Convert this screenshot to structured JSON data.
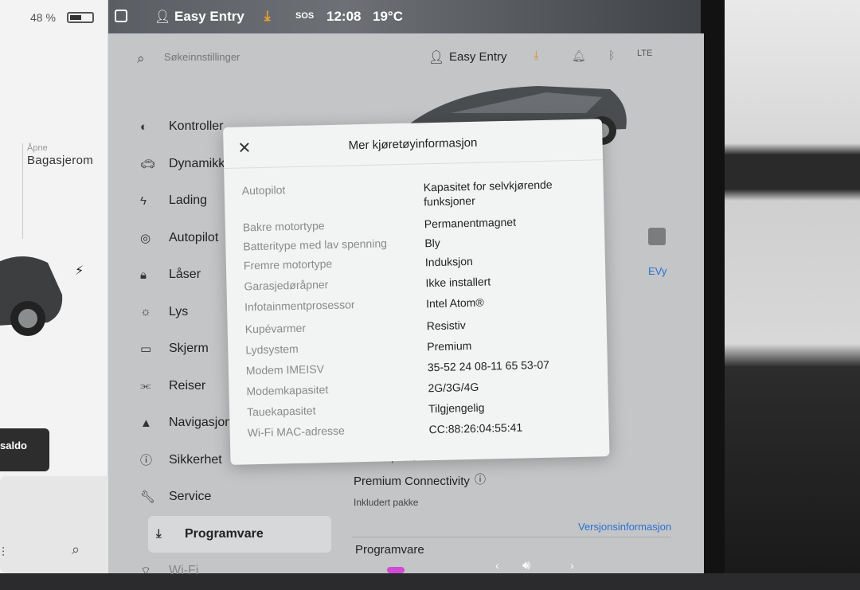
{
  "left_panel": {
    "battery_percent": "48 %",
    "trunk_small": "Åpne",
    "trunk_label": "Bagasjerom",
    "saldo_label": "saldo"
  },
  "statusbar": {
    "profile": "Easy Entry",
    "sos": "SOS",
    "time": "12:08",
    "temperature": "19°C"
  },
  "header": {
    "search_placeholder": "Søkeinnstillinger",
    "profile": "Easy Entry",
    "signal_label": "LTE"
  },
  "menu": [
    {
      "label": "Kontroller",
      "icon": "toggle-icon"
    },
    {
      "label": "Dynamikk",
      "icon": "car-icon"
    },
    {
      "label": "Lading",
      "icon": "bolt-icon"
    },
    {
      "label": "Autopilot",
      "icon": "steering-wheel-icon"
    },
    {
      "label": "Låser",
      "icon": "lock-icon"
    },
    {
      "label": "Lys",
      "icon": "sun-icon"
    },
    {
      "label": "Skjerm",
      "icon": "display-icon"
    },
    {
      "label": "Reiser",
      "icon": "route-icon"
    },
    {
      "label": "Navigasjon",
      "icon": "navigation-icon"
    },
    {
      "label": "Sikkerhet",
      "icon": "info-icon"
    },
    {
      "label": "Service",
      "icon": "wrench-icon"
    },
    {
      "label": "Programvare",
      "icon": "download-icon"
    },
    {
      "label": "Wi-Fi",
      "icon": "wifi-icon"
    }
  ],
  "main": {
    "evy_label": "EVy",
    "package_included_1": "Inkludert pakke",
    "premium_connectivity": "Premium Connectivity",
    "package_included_2": "Inkludert pakke",
    "version_info_link": "Versjonsinformasjon",
    "software_title": "Programvare"
  },
  "modal": {
    "title": "Mer kjøretøyinformasjon",
    "rows": [
      {
        "label": "Autopilot",
        "value": "Kapasitet for selvkjørende funksjoner"
      },
      {
        "label": "Bakre motortype",
        "value": "Permanentmagnet"
      },
      {
        "label": "Batteritype med lav spenning",
        "value": "Bly"
      },
      {
        "label": "Fremre motortype",
        "value": "Induksjon"
      },
      {
        "label": "Garasjedøråpner",
        "value": "Ikke installert"
      },
      {
        "label": "Infotainmentprosessor",
        "value": "Intel Atom®"
      },
      {
        "label": "Kupévarmer",
        "value": "Resistiv"
      },
      {
        "label": "Lydsystem",
        "value": "Premium"
      },
      {
        "label": "Modem IMEISV",
        "value": "35-52 24 08-11 65 53-07"
      },
      {
        "label": "Modemkapasitet",
        "value": "2G/3G/4G"
      },
      {
        "label": "Tauekapasitet",
        "value": "Tilgjengelig"
      },
      {
        "label": "Wi-Fi MAC-adresse",
        "value": "CC:88:26:04:55:41"
      }
    ]
  }
}
